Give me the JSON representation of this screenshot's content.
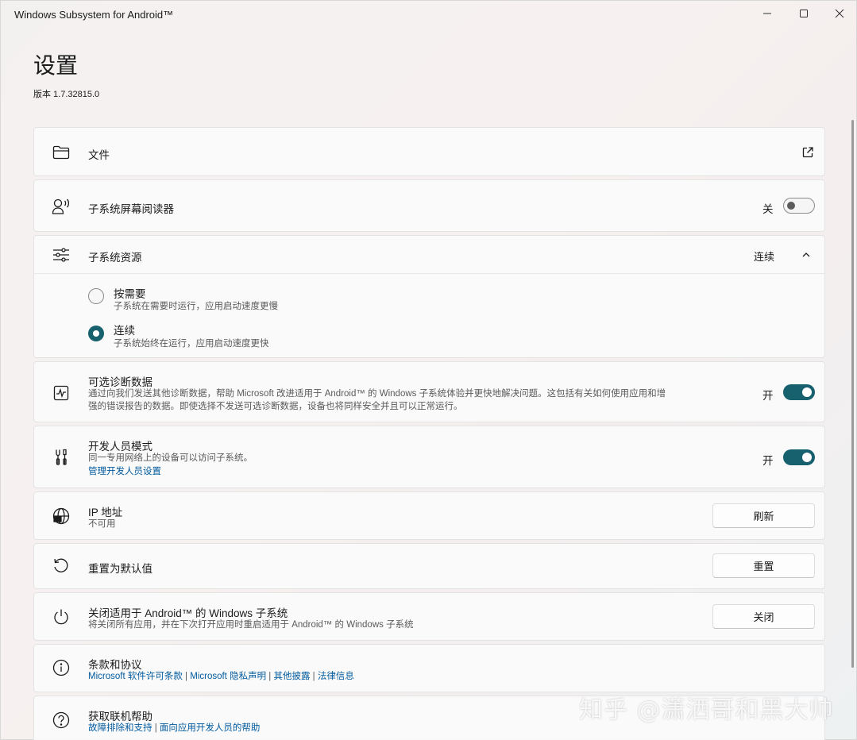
{
  "window": {
    "title": "Windows Subsystem for Android™"
  },
  "header": {
    "title": "设置",
    "version": "版本 1.7.32815.0"
  },
  "settings": {
    "files": {
      "label": "文件",
      "icon": "folder-icon",
      "action_icon": "open-external-icon"
    },
    "screen_reader": {
      "label": "子系统屏幕阅读器",
      "icon": "narrator-icon",
      "state_text": "关",
      "enabled": false
    },
    "resources": {
      "label": "子系统资源",
      "icon": "sliders-icon",
      "value": "连续",
      "options": [
        {
          "title": "按需要",
          "desc": "子系统在需要时运行，应用启动速度更慢",
          "selected": false
        },
        {
          "title": "连续",
          "desc": "子系统始终在运行，应用启动速度更快",
          "selected": true
        }
      ]
    },
    "diagnostics": {
      "label": "可选诊断数据",
      "icon": "activity-icon",
      "desc_line1": "通过向我们发送其他诊断数据，帮助 Microsoft 改进适用于 Android™ 的 Windows 子系统体验并更快地解决问题。这包括有关如何使用应用和增",
      "desc_line2": "强的错误报告的数据。即使选择不发送可选诊断数据，设备也将同样安全并且可以正常运行。",
      "state_text": "开",
      "enabled": true
    },
    "developer": {
      "label": "开发人员模式",
      "icon": "developer-tools-icon",
      "desc": "同一专用网络上的设备可以访问子系统。",
      "link": "管理开发人员设置",
      "state_text": "开",
      "enabled": true
    },
    "ip": {
      "label": "IP 地址",
      "icon": "globe-network-icon",
      "value": "不可用",
      "button": "刷新"
    },
    "reset": {
      "label": "重置为默认值",
      "icon": "reset-icon",
      "button": "重置"
    },
    "shutdown": {
      "label": "关闭适用于 Android™ 的 Windows 子系统",
      "icon": "power-icon",
      "desc": "将关闭所有应用，并在下次打开应用时重启适用于 Android™ 的 Windows 子系统",
      "button": "关闭"
    },
    "terms": {
      "label": "条款和协议",
      "icon": "info-icon",
      "links": [
        "Microsoft 软件许可条款",
        "Microsoft 隐私声明",
        "其他披露",
        "法律信息"
      ],
      "separator": " | "
    },
    "help": {
      "label": "获取联机帮助",
      "icon": "help-icon",
      "links": [
        "故障排除和支持",
        "面向应用开发人员的帮助"
      ],
      "separator": " | "
    }
  },
  "watermark": "知乎 @潇洒哥和黑大帅",
  "colors": {
    "accent": "#17606e",
    "link": "#005a9e"
  }
}
